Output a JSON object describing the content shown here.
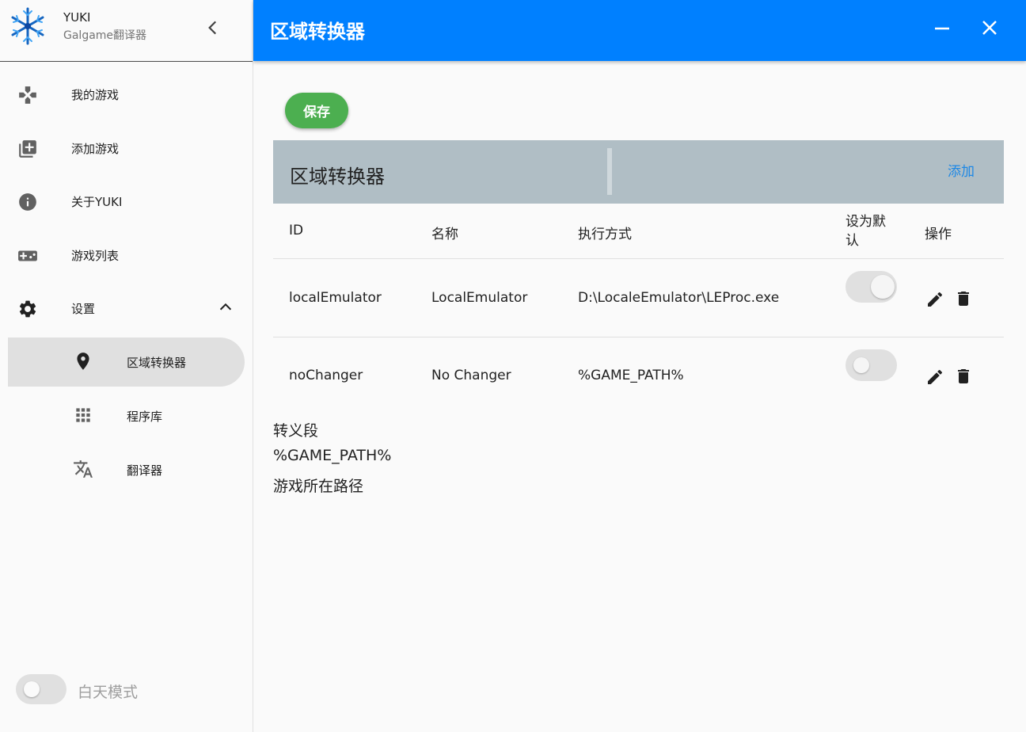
{
  "sidebar": {
    "brand_title": "YUKI",
    "brand_subtitle": "Galgame翻译器",
    "items": [
      {
        "label": "我的游戏",
        "icon": "gamepad-cross-icon"
      },
      {
        "label": "添加游戏",
        "icon": "library-add-icon"
      },
      {
        "label": "关于YUKI",
        "icon": "info-icon"
      },
      {
        "label": "游戏列表",
        "icon": "game-controller-icon"
      },
      {
        "label": "设置",
        "icon": "gear-icon"
      }
    ],
    "sub_items": [
      {
        "label": "区域转换器",
        "icon": "location-pin-icon",
        "active": true
      },
      {
        "label": "程序库",
        "icon": "grid-apps-icon",
        "active": false
      },
      {
        "label": "翻译器",
        "icon": "translate-icon",
        "active": false
      }
    ],
    "day_mode_label": "白天模式",
    "day_mode_on": false
  },
  "topbar": {
    "title": "区域转换器"
  },
  "main": {
    "save_label": "保存",
    "table_title": "区域转换器",
    "add_label": "添加",
    "columns": [
      "ID",
      "名称",
      "执行方式",
      "设为默\n认",
      "操作"
    ],
    "rows": [
      {
        "id": "localEmulator",
        "name": "LocalEmulator",
        "exec": "D:\\LocaleEmulator\\LEProc.exe",
        "is_default": true
      },
      {
        "id": "noChanger",
        "name": "No Changer",
        "exec": "%GAME_PATH%",
        "is_default": false
      }
    ],
    "notes": [
      "转义段",
      "%GAME_PATH%",
      "游戏所在路径"
    ]
  },
  "colors": {
    "accent": "#0080ff",
    "save": "#4caf50",
    "table_header": "#b0bec5",
    "link": "#1e88e5"
  }
}
